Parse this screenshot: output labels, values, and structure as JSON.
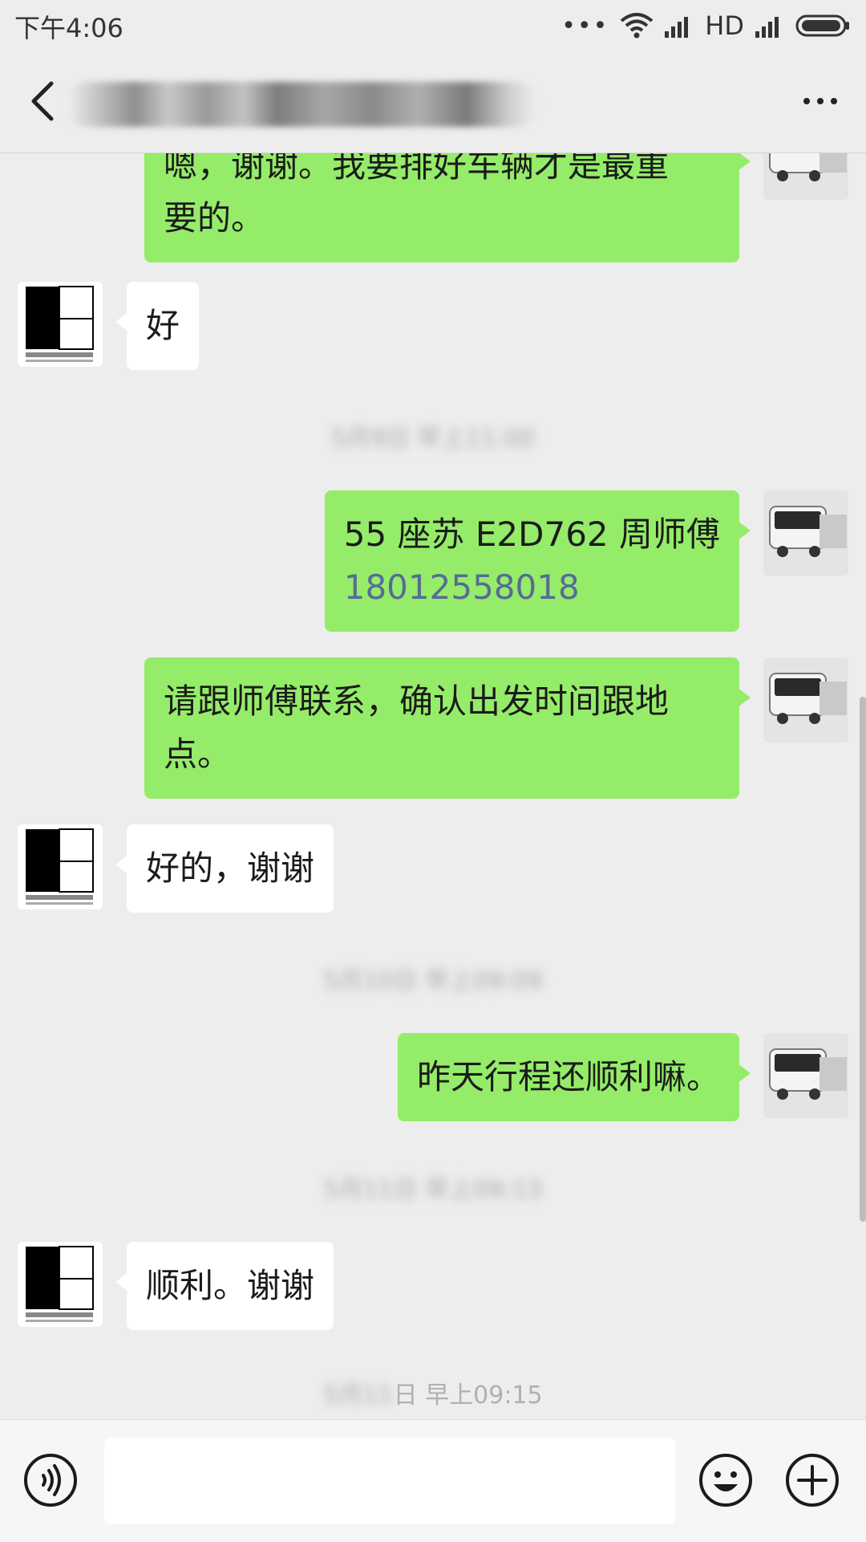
{
  "status_bar": {
    "time": "下午4:06",
    "network": "HD"
  },
  "header": {
    "title": ""
  },
  "messages": [
    {
      "side": "right",
      "text_lines": [
        "嗯，谢谢。我要排好车辆才是最重",
        "要的。"
      ]
    },
    {
      "side": "left",
      "text": "好"
    },
    {
      "side": "right",
      "text": "55 座苏 E2D762 周师傅",
      "phone": "18012558018"
    },
    {
      "side": "right",
      "text_lines": [
        "请跟师傅联系，确认出发时间跟地",
        "点。"
      ]
    },
    {
      "side": "left",
      "text": "好的，谢谢"
    },
    {
      "side": "right",
      "text": "昨天行程还顺利嘛。"
    },
    {
      "side": "left",
      "text": "顺利。谢谢"
    }
  ],
  "timestamps": [
    {
      "text": "5月9日 早上11:00"
    },
    {
      "text": "5月10日 早上09:09"
    },
    {
      "text": "5月11日 早上09:13"
    },
    {
      "clear": "日 早上09:15"
    }
  ],
  "colors": {
    "bubble_self": "#95ec69",
    "bubble_other": "#ffffff",
    "background": "#ededed",
    "link": "#576b95"
  },
  "icons": [
    "back-icon",
    "more-icon",
    "voice-icon",
    "emoji-icon",
    "plus-icon",
    "wifi-icon",
    "signal-icon",
    "battery-icon"
  ]
}
